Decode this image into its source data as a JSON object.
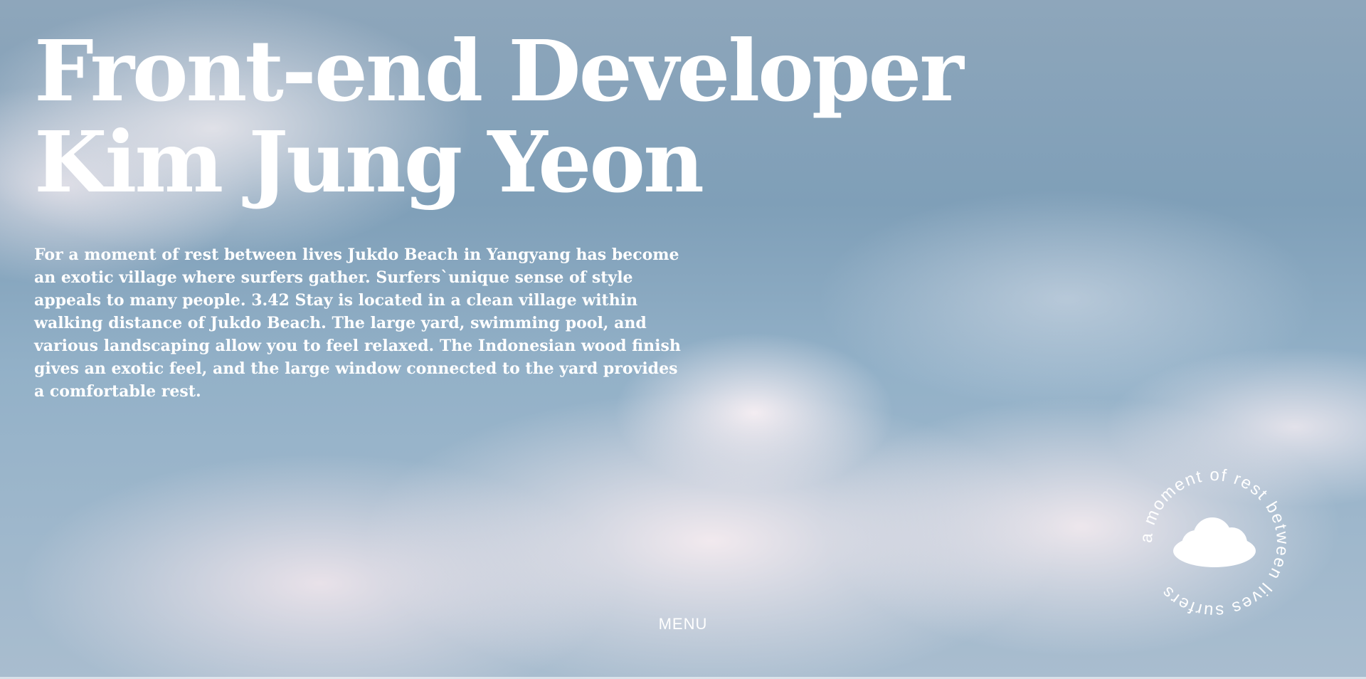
{
  "hero": {
    "title_line1": "Front-end Developer",
    "title_line2": "Kim Jung Yeon",
    "description": "For a moment of rest between lives Jukdo Beach in Yangyang has become an exotic village where surfers gather. Surfers`unique sense of style appeals to many people. 3.42 Stay is located in a clean village within walking distance of Jukdo Beach. The large yard, swimming pool, and various landscaping allow you to feel relaxed. The Indonesian wood finish gives an exotic feel, and the large window connected to the yard provides a comfortable rest."
  },
  "nav": {
    "menu_label": "MENU"
  },
  "badge": {
    "circle_text": "a moment of rest between lives surfers ",
    "icon": "cloud-icon"
  },
  "colors": {
    "text": "#ffffff",
    "sky": "#8fa9bf"
  }
}
